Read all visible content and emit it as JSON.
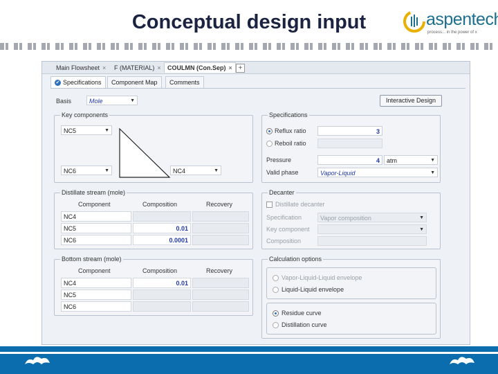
{
  "slide": {
    "title": "Conceptual design input",
    "logo_text": "aspentech",
    "logo_tagline": "process... in the power of x"
  },
  "tabs": {
    "doc_tabs": [
      {
        "label": "Main Flowsheet",
        "close": "×"
      },
      {
        "label": "F (MATERIAL)",
        "close": "×"
      },
      {
        "label": "COULMN (Con.Sep)",
        "close": "×"
      }
    ],
    "add": "+",
    "sub_tabs": [
      {
        "label": "Specifications"
      },
      {
        "label": "Component Map"
      },
      {
        "label": "Comments"
      }
    ],
    "check": "✔"
  },
  "form": {
    "basis_label": "Basis",
    "basis_value": "Mole",
    "interactive_button": "Interactive Design",
    "key_components": {
      "title": "Key components",
      "top": "NC5",
      "bottom_left": "NC6",
      "bottom_right": "NC4"
    },
    "specifications": {
      "title": "Specifications",
      "reflux_label": "Reflux ratio",
      "reflux_value": "3",
      "reboil_label": "Reboil ratio",
      "pressure_label": "Pressure",
      "pressure_value": "4",
      "pressure_unit": "atm",
      "valid_phase_label": "Valid phase",
      "valid_phase_value": "Vapor-Liquid"
    },
    "distillate": {
      "title": "Distillate stream (mole)",
      "headers": [
        "Component",
        "Composition",
        "Recovery"
      ],
      "rows": [
        {
          "name": "NC4",
          "composition": "",
          "recovery": ""
        },
        {
          "name": "NC5",
          "composition": "0.01",
          "recovery": ""
        },
        {
          "name": "NC6",
          "composition": "0.0001",
          "recovery": ""
        }
      ]
    },
    "bottom": {
      "title": "Bottom stream (mole)",
      "headers": [
        "Component",
        "Composition",
        "Recovery"
      ],
      "rows": [
        {
          "name": "NC4",
          "composition": "0.01",
          "recovery": ""
        },
        {
          "name": "NC5",
          "composition": "",
          "recovery": ""
        },
        {
          "name": "NC6",
          "composition": "",
          "recovery": ""
        }
      ]
    },
    "decanter": {
      "title": "Decanter",
      "distillate_decanter": "Distillate decanter",
      "specification_label": "Specification",
      "specification_value": "Vapor composition",
      "key_component_label": "Key component",
      "composition_label": "Composition"
    },
    "calculation": {
      "title": "Calculation options",
      "vll_envelope": "Vapor-Liquid-Liquid envelope",
      "ll_envelope": "Liquid-Liquid envelope",
      "residue_curve": "Residue curve",
      "distillation_curve": "Distillation curve"
    },
    "dropdown_arrow": "▼"
  }
}
